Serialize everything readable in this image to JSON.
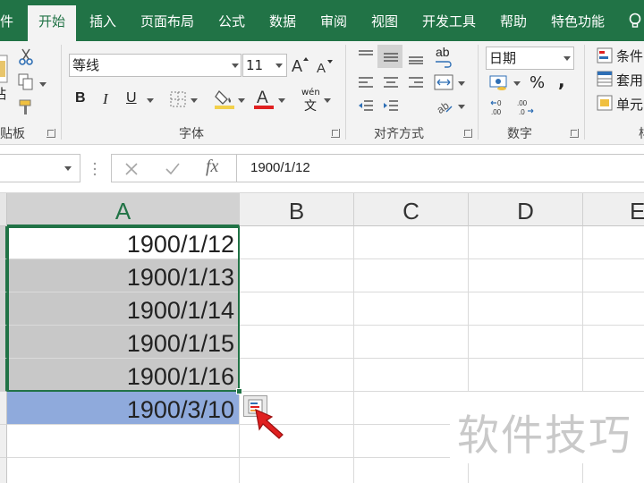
{
  "ribbon_tabs": [
    "件",
    "开始",
    "插入",
    "页面布局",
    "公式",
    "数据",
    "审阅",
    "视图",
    "开发工具",
    "帮助",
    "特色功能"
  ],
  "active_tab": "开始",
  "clipboard": {
    "paste_label": "粘",
    "group_label": "贴板"
  },
  "font": {
    "name": "等线",
    "size": "11",
    "bold": "B",
    "italic": "I",
    "underline": "U",
    "phonetic": "wén",
    "phonetic_char": "文",
    "group_label": "字体"
  },
  "alignment": {
    "wrap_label": "ab",
    "group_label": "对齐方式"
  },
  "number": {
    "format": "日期",
    "percent": "%",
    "comma": ",",
    "group_label": "数字"
  },
  "styles": {
    "conditional": "条件",
    "table_format": "套用",
    "cell_styles": "单元",
    "group_label": "样"
  },
  "formula_bar": {
    "fx": "fx",
    "value": "1900/1/12"
  },
  "columns": [
    "A",
    "B",
    "C",
    "D",
    "E"
  ],
  "selected_column": "A",
  "cells_a": [
    "1900/1/12",
    "1900/1/13",
    "1900/1/14",
    "1900/1/15",
    "1900/1/16",
    "1900/3/10"
  ],
  "watermark": "软件技巧",
  "colors": {
    "accent": "#217346",
    "highlight_blue": "#8faadc",
    "selection_gray": "#c8c8c8",
    "arrow_red": "#e02020"
  }
}
